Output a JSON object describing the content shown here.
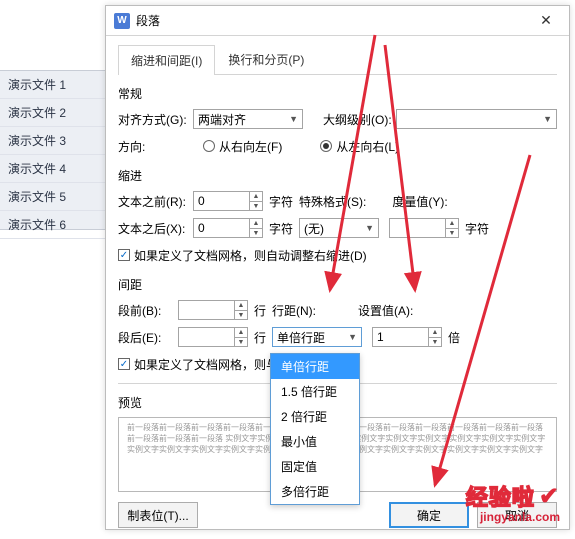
{
  "background": {
    "items": [
      "演示文件 1",
      "演示文件 2",
      "演示文件 3",
      "演示文件 4",
      "演示文件 5",
      "演示文件 6"
    ]
  },
  "dialog": {
    "title": "段落",
    "close": "✕",
    "tabs": {
      "indent": "缩进和间距(I)",
      "paging": "换行和分页(P)"
    },
    "general": {
      "title": "常规",
      "align_label": "对齐方式(G):",
      "align_value": "两端对齐",
      "outline_label": "大纲级别(O):",
      "outline_value": "",
      "direction_label": "方向:",
      "rtl_label": "从右向左(F)",
      "ltr_label": "从左向右(L)"
    },
    "indent": {
      "title": "缩进",
      "before_label": "文本之前(R):",
      "before_value": "0",
      "after_label": "文本之后(X):",
      "after_value": "0",
      "unit_char": "字符",
      "special_label": "特殊格式(S):",
      "special_value": "(无)",
      "measure_label": "度量值(Y):",
      "measure_value": "",
      "auto_adjust_label": "如果定义了文档网格，则自动调整右缩进(D)"
    },
    "spacing": {
      "title": "间距",
      "before_label": "段前(B):",
      "before_value": "",
      "after_label": "段后(E):",
      "after_value": "",
      "unit_line": "行",
      "linespacing_label": "行距(N):",
      "linespacing_value": "单倍行距",
      "setvalue_label": "设置值(A):",
      "setvalue_value": "1",
      "setvalue_unit": "倍",
      "grid_label": "如果定义了文档网格，则与网格对",
      "options": [
        "单倍行距",
        "1.5 倍行距",
        "2 倍行距",
        "最小值",
        "固定值",
        "多倍行距"
      ]
    },
    "preview": {
      "title": "预览",
      "text": "前一段落前一段落前一段落前一段落前一段落前一段落前一段落前一段落前一段落前一段落前一段落前一段落前一段落前一段落前一段落前一段落\n实例文字实例文字实例文字实例文字实例文字实例文字实例文字实例文字实例文字实例文字实例文字实例文字实例文字实例文字实例文字实例文字实例文字实例文字实例文字实例文字实例文字实例文字实例文字"
    },
    "buttons": {
      "tabstop": "制表位(T)...",
      "ok": "确定",
      "cancel": "取消"
    }
  },
  "watermark": {
    "line1": "经验啦",
    "line2": "jingyanla.com"
  }
}
